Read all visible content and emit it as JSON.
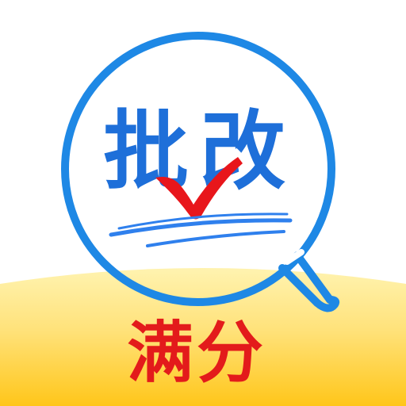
{
  "icon": {
    "title": "批改",
    "subtitle": "满分",
    "colors": {
      "magnifier": "#1E88E5",
      "title_text": "#1E6FD9",
      "checkmark": "#E8161B",
      "underline": "#2F80ED",
      "banner_top": "#FFE082",
      "banner_bottom": "#FFC107",
      "subtitle_text": "#E31B1B",
      "background": "#FFFFFF"
    },
    "icons": [
      "magnifier-icon",
      "checkmark-icon"
    ]
  }
}
